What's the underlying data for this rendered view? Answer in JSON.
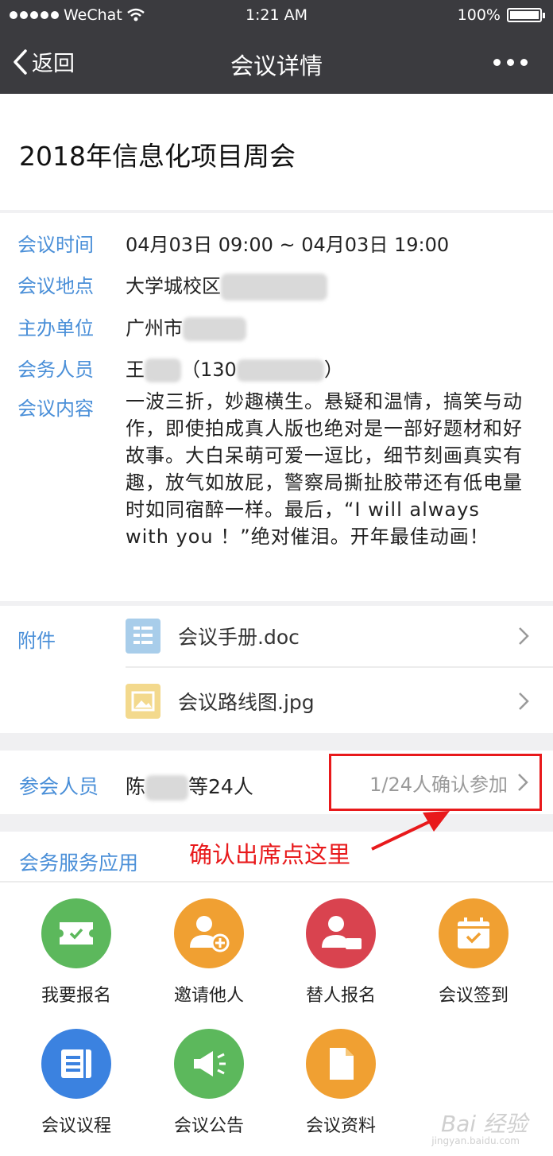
{
  "status_bar": {
    "carrier": "WeChat",
    "time": "1:21 AM",
    "battery": "100%"
  },
  "nav": {
    "back_label": "返回",
    "title": "会议详情"
  },
  "meeting": {
    "title": "2018年信息化项目周会",
    "time_label": "会议时间",
    "time_value": "04月03日  09:00 ~ 04月03日  19:00",
    "location_label": "会议地点",
    "location_value": "大学城校区",
    "organizer_label": "主办单位",
    "organizer_value": "广州市",
    "staff_label": "会务人员",
    "staff_name": "王",
    "staff_phone_prefix": "（130",
    "staff_phone_suffix": "）",
    "content_label": "会议内容",
    "content_value": "一波三折，妙趣横生。悬疑和温情，搞笑与动作，即使拍成真人版也绝对是一部好题材和好故事。大白呆萌可爱一逗比，细节刻画真实有趣，放气如放屁，警察局撕扯胶带还有低电量时如同宿醉一样。最后，“I will always with you ！”绝对催泪。开年最佳动画！"
  },
  "attachments": {
    "label": "附件",
    "items": [
      {
        "name": "会议手册.doc",
        "icon": "doc-file-icon",
        "color": "#a8cdea"
      },
      {
        "name": "会议路线图.jpg",
        "icon": "image-file-icon",
        "color": "#f3d98d"
      }
    ]
  },
  "participants": {
    "label": "参会人员",
    "names_prefix": "陈",
    "names_suffix": "等24人",
    "confirm_text": "1/24人确认参加"
  },
  "annotation": {
    "text": "确认出席点这里",
    "color": "#e8191b"
  },
  "services": {
    "label": "会务服务应用",
    "apps": [
      {
        "name": "我要报名",
        "icon": "ticket-icon",
        "color": "#5cb85c"
      },
      {
        "name": "邀请他人",
        "icon": "add-person-icon",
        "color": "#f0a032"
      },
      {
        "name": "替人报名",
        "icon": "person-ticket-icon",
        "color": "#d9434f"
      },
      {
        "name": "会议签到",
        "icon": "calendar-check-icon",
        "color": "#f0a032"
      },
      {
        "name": "会议议程",
        "icon": "agenda-list-icon",
        "color": "#3b82e0"
      },
      {
        "name": "会议公告",
        "icon": "megaphone-icon",
        "color": "#5cb85c"
      },
      {
        "name": "会议资料",
        "icon": "document-icon",
        "color": "#f0a032"
      }
    ]
  },
  "watermark": {
    "text": "Bai 经验",
    "sub": "jingyan.baidu.com"
  }
}
